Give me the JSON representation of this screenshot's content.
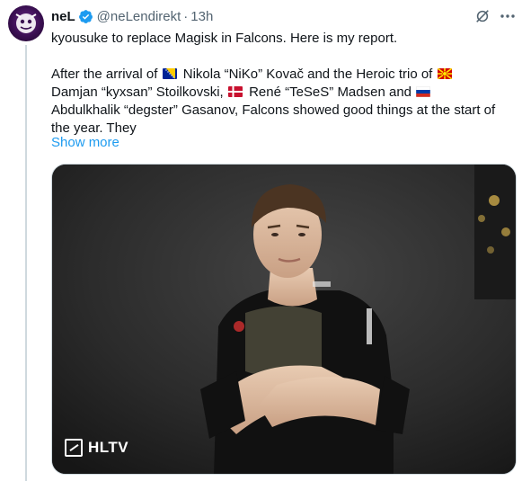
{
  "tweet": {
    "display_name": "neL",
    "handle": "@neLendirekt",
    "separator": "·",
    "time": "13h",
    "lines": [
      "kyousuke to replace Magisk in Falcons. Here is my report.",
      "",
      "After the arrival of",
      "Nikola “NiKo” Kovač and the Heroic trio of",
      "Damjan “kyxsan” Stoilkovski,",
      "René “TeSeS” Madsen and",
      "Abdulkhalik “degster” Gasanov, Falcons showed good things at the start of",
      "the year. They"
    ],
    "show_more": "Show more",
    "flags": [
      "flag-bosnia-icon",
      "flag-north-macedonia-icon",
      "flag-denmark-icon",
      "flag-russia-icon"
    ]
  },
  "media": {
    "watermark": "HLTV",
    "description_colors": {
      "background": "#2a2a2a",
      "shirt": "#111111",
      "skin": "#e2c3a8"
    }
  },
  "colors": {
    "accent": "#1d9bf0",
    "muted": "#536471",
    "text": "#0f1419"
  }
}
